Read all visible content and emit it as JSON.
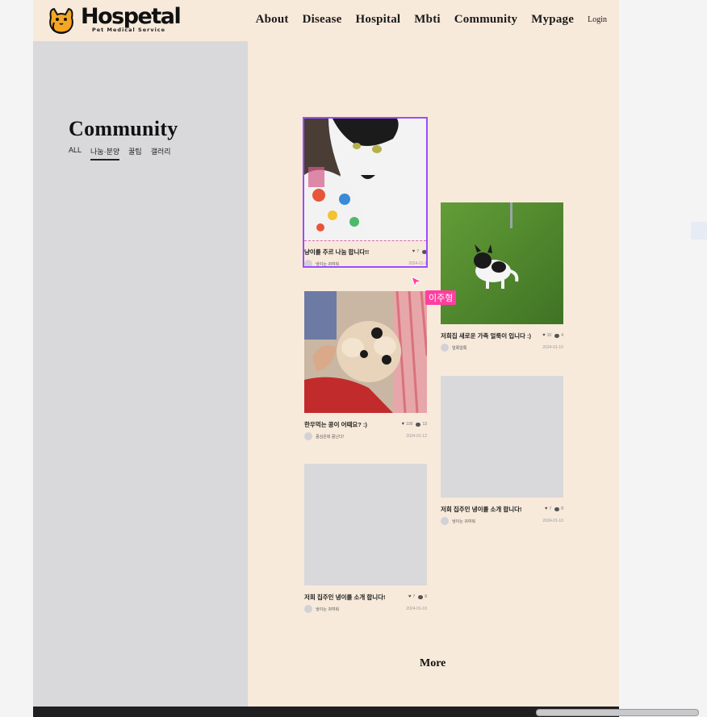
{
  "brand": {
    "name": "Hospetal",
    "tagline": "Pet Medical Service"
  },
  "nav": {
    "items": [
      "About",
      "Disease",
      "Hospital",
      "Mbti",
      "Community",
      "Mypage"
    ],
    "login": "Login"
  },
  "sidebar": {
    "title": "Community",
    "tabs": [
      "ALL",
      "나눔·분양",
      "꿀팁",
      "갤러리"
    ],
    "active_tab": "나눔·분양"
  },
  "posts": [
    {
      "title": "냥이를 주르 나눔 합니다!!",
      "likes": "7",
      "comments": "",
      "author": "냉이는 귀여워",
      "date": "2024-01-1",
      "image": "cat-black-white"
    },
    {
      "title": "저희집 새로운 가족 얼룩이 입니다 :)",
      "likes": "10",
      "comments": "4",
      "author": "얼룩얼룩",
      "date": "2024-01-10",
      "image": "puppy-on-grass"
    },
    {
      "title": "한우먹는 콩이 어때요? :)",
      "likes": "100",
      "comments": "13",
      "author": "콩심은데 콩난다!",
      "date": "2024-01-12",
      "image": "small-fluffy-dog"
    },
    {
      "title": "저희 집주인 냉이를 소개 합니다!",
      "likes": "7",
      "comments": "8",
      "author": "냉이는 귀여워",
      "date": "2024-01-10",
      "image": ""
    },
    {
      "title": "저희 집주인 냉이를 소개 합니다!",
      "likes": "7",
      "comments": "8",
      "author": "냉이는 귀여워",
      "date": "2024-01-10",
      "image": ""
    }
  ],
  "cursor_label": "이주형",
  "more_label": "More",
  "colors": {
    "page_bg": "#f8eadb",
    "sidebar_bg": "#d9d9db",
    "selection": "#9b4dff",
    "cursor_tag": "#ff3fa0"
  }
}
